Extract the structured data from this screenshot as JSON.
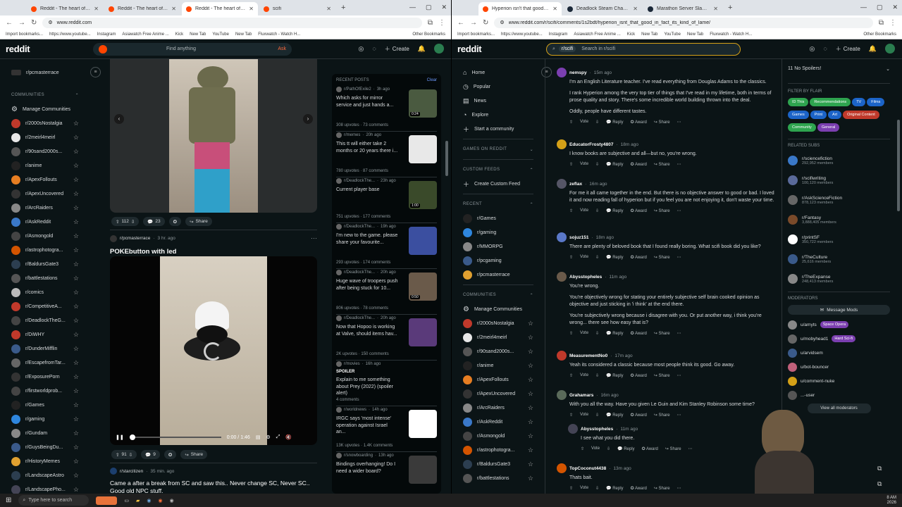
{
  "left": {
    "tabs": [
      {
        "label": "Reddit - The heart of the intern",
        "active": false
      },
      {
        "label": "Reddit - The heart of the intern",
        "active": false
      },
      {
        "label": "Reddit - The heart of the intern",
        "active": true
      },
      {
        "label": "scifi",
        "active": false
      }
    ],
    "url": "www.reddit.com",
    "bookmarks": [
      "Import bookmarks...",
      "https://www.youtube...",
      "Instagram",
      "Asiawatch Free Anime ...",
      "Kick",
      "New Tab",
      "YouTube",
      "New Tab",
      "Fluxwatch - Watch H..."
    ],
    "bookmarks_other": "Other Bookmarks",
    "header": {
      "logo": "reddit",
      "search": "Find anything",
      "ask": "Ask",
      "create": "Create"
    },
    "sidebar": {
      "top_item": "r/pcmasterrace",
      "communities_title": "COMMUNITIES",
      "manage": "Manage Communities",
      "items": [
        "r/2000sNostalgia",
        "r/2meirl4meirl",
        "r/90sand2000s...",
        "r/anime",
        "r/ApexFollouts",
        "r/ApexUncovered",
        "r/ArcRaiders",
        "r/AskReddit",
        "r/Asmongold",
        "r/astrophotogra...",
        "r/BaldursGate3",
        "r/battlestations",
        "r/comics",
        "r/CompetitiveA...",
        "r/DeadlockTheG...",
        "r/DiWHY",
        "r/DunderMifflin",
        "r/EscapefromTar...",
        "r/ExposurePorn",
        "r/firstworldprob...",
        "r/Games",
        "r/gaming",
        "r/Gundam",
        "r/GuysBeingDu...",
        "r/HistoryMemes",
        "r/LandscapeAstro",
        "r/LandscapePho..."
      ]
    },
    "post1": {
      "upvotes": "112",
      "comments": "23",
      "share": "Share"
    },
    "post2": {
      "sub": "r/pcmasterrace",
      "time": "3 hr. ago",
      "title": "POKEbutton with led",
      "upvotes": "91",
      "comments": "9",
      "share": "Share",
      "video_time": "0:00 / 1:46"
    },
    "post3": {
      "sub": "r/starcitizen",
      "time": "35 min. ago",
      "title": "Came a after a break from SC and saw this.. Never change SC, Never SC.. Good old NPC stuff."
    },
    "recent": {
      "title": "RECENT POSTS",
      "clear": "Clear",
      "items": [
        {
          "sub": "r/PathOfExile2",
          "time": "3h ago",
          "title": "Which asks for mirror service and just hands a...",
          "stats": "308 upvotes · 73 comments",
          "thumb": "#4a5a40",
          "dur": "0:24"
        },
        {
          "sub": "r/memes",
          "time": "20h ago",
          "title": "This tt will either take 2 months or 20 years there i...",
          "stats": "780 upvotes · 87 comments",
          "thumb": "#e8e8e8",
          "dur": ""
        },
        {
          "sub": "r/DeadlockThe...",
          "time": "23h ago",
          "title": "Current player base",
          "stats": "751 upvotes · 177 comments",
          "thumb": "#3a4a2a",
          "dur": "1:00"
        },
        {
          "sub": "r/DeadlockThe...",
          "time": "19h ago",
          "title": "I'm new to the game. please share your favourite...",
          "stats": "293 upvotes · 174 comments",
          "thumb": "#3b4fa0",
          "dur": ""
        },
        {
          "sub": "r/DeadlockThe...",
          "time": "20h ago",
          "title": "Huge wave of troopers push after being stuck for 10...",
          "stats": "806 upvotes · 78 comments",
          "thumb": "#6a5a4a",
          "dur": "0:50"
        },
        {
          "sub": "r/DeadlockThe...",
          "time": "20h ago",
          "title": "Now that Hopoo is working at Valve, should items hav...",
          "stats": "2K upvotes · 150 comments",
          "thumb": "#5a3a7a",
          "dur": ""
        },
        {
          "sub": "r/movies",
          "time": "16h ago",
          "title": "Explain to me something about Prey (2022) (spoiler alert)",
          "stats": "4 comments",
          "thumb": "",
          "dur": "",
          "spoiler": "SPOILER"
        },
        {
          "sub": "r/worldnews",
          "time": "14h ago",
          "title": "IRGC says 'most intense' operation against Israel an...",
          "stats": "13K upvotes · 1.4K comments",
          "thumb": "#ffffff",
          "dur": ""
        },
        {
          "sub": "r/snowboarding",
          "time": "13h ago",
          "title": "Bindings overhanging! Do I need a wider board?",
          "stats": "",
          "thumb": "#3a3a3a",
          "dur": ""
        }
      ]
    }
  },
  "right": {
    "tabs": [
      {
        "label": "Hyperion isn't that good, in fa",
        "active": true
      },
      {
        "label": "Deadlock Steam Charts - Steam",
        "active": false
      },
      {
        "label": "Marathon Server Slam Steam D",
        "active": false
      }
    ],
    "url": "www.reddit.com/r/scifi/comments/1s2bdt/hyperion_isnt_that_good_in_fact_its_kind_of_lame/",
    "bookmarks": [
      "Import bookmarks...",
      "https://www.youtube...",
      "Instagram",
      "Asiawatch Free Anime ...",
      "Kick",
      "New Tab",
      "YouTube",
      "New Tab",
      "Fluxwatch - Watch H..."
    ],
    "bookmarks_other": "Other Bookmarks",
    "header": {
      "logo": "reddit",
      "search_chip": "r/scifi",
      "search": "Search in r/scifi",
      "create": "Create"
    },
    "nav": {
      "home": "Home",
      "popular": "Popular",
      "news": "News",
      "explore": "Explore",
      "start": "Start a community",
      "games": "GAMES ON REDDIT",
      "custom": "CUSTOM FEEDS",
      "create_feed": "Create Custom Feed",
      "recent": "RECENT",
      "communities": "COMMUNITIES",
      "manage": "Manage Communities"
    },
    "recent_items": [
      "r/Games",
      "r/gaming",
      "r/MMORPG",
      "r/pcgaming",
      "r/pcmasterrace"
    ],
    "community_items": [
      "r/2000sNostalgia",
      "r/2meirl4meirl",
      "r/90sand2000s...",
      "r/anime",
      "r/ApexFollouts",
      "r/ApexUncovered",
      "r/ArcRaiders",
      "r/AskReddit",
      "r/Asmongold",
      "r/astrophotogra...",
      "r/BaldursGate3",
      "r/battlestations"
    ],
    "comments": [
      {
        "user": "nemspy",
        "time": "15m ago",
        "paras": [
          "I'm an English Literature teacher. I've read everything from Douglas Adams to the classics.",
          "I rank Hyperion among the very top tier of things that I've read in my lifetime, both in terms of prose quality and story. There's some incredible world building thrown into the deal.",
          "Oddly, people have different tastes."
        ]
      },
      {
        "user": "EducatorFrosty4807",
        "time": "18m ago",
        "paras": [
          "I know books are subjective and all—but no, you're wrong."
        ]
      },
      {
        "user": "zeflax",
        "time": "16m ago",
        "paras": [
          "For me it all came together in the end. But there is no objective answer to good or bad. I loved it and now reading fall of hyperion but if you feel you are not enjoying it, don't waste your time."
        ]
      },
      {
        "user": "sojuz151",
        "time": "18m ago",
        "paras": [
          "There are plenty of beloved book that I found really boring. What scifi book did you like?"
        ]
      },
      {
        "user": "Abysstopheles",
        "time": "11m ago",
        "paras": [
          "You're wrong.",
          "You're objectively wrong for stating your entirely subjective self brain cooked opinion as objective and just sticking in 'i think' at the end there.",
          "You're subjectively wrong because i disagree with you. Or put another way, i think you're wrong... there see how easy that is?"
        ]
      },
      {
        "user": "MeasurementNo0",
        "time": "17m ago",
        "paras": [
          "Yeah its considered a classic because most people think its good. Go away."
        ]
      },
      {
        "user": "Grahamars",
        "time": "16m ago",
        "paras": [
          "With you all the way. Have you given Le Guin and Kim Stanley Robinson some time?"
        ]
      },
      {
        "user": "Abysstopheles",
        "time": "11m ago",
        "paras": [
          "I see what you did there."
        ]
      },
      {
        "user": "TopCoconut4438",
        "time": "13m ago",
        "paras": [
          "Thats bait."
        ]
      }
    ],
    "actions": {
      "vote": "Vote",
      "reply": "Reply",
      "award": "Award",
      "share": "Share"
    },
    "sidebar": {
      "rule": "11  No Spoilers!",
      "flair_title": "FILTER BY FLAIR",
      "flairs": [
        {
          "label": "ID This",
          "color": "#2ea44f"
        },
        {
          "label": "Recommendations",
          "color": "#2ea44f"
        },
        {
          "label": "TV",
          "color": "#1c64c8"
        },
        {
          "label": "Films",
          "color": "#1c64c8"
        },
        {
          "label": "Games",
          "color": "#1c64c8"
        },
        {
          "label": "Print",
          "color": "#1c64c8"
        },
        {
          "label": "Art",
          "color": "#1c64c8"
        },
        {
          "label": "Original Content",
          "color": "#c0392b"
        },
        {
          "label": "Community",
          "color": "#2ea44f"
        },
        {
          "label": "General",
          "color": "#7b3fb0"
        }
      ],
      "related_title": "RELATED SUBS",
      "related": [
        {
          "name": "r/sciencefiction",
          "members": "292,952 members"
        },
        {
          "name": "r/scifiwriting",
          "members": "100,120 members"
        },
        {
          "name": "r/AskScienceFiction",
          "members": "878,123 members"
        },
        {
          "name": "r/Fantasy",
          "members": "3,888,405 members"
        },
        {
          "name": "r/printSF",
          "members": "350,722 members"
        },
        {
          "name": "r/TheCulture",
          "members": "25,616 members"
        },
        {
          "name": "r/TheExpanse",
          "members": "248,413 members"
        }
      ],
      "mods_title": "MODERATORS",
      "message_mods": "Message Mods",
      "mods": [
        {
          "name": "u/amyts",
          "tag": "Space Opera",
          "tagcolor": "#7b3fb0"
        },
        {
          "name": "u/mobyhead1",
          "tag": "Hard Sci-fi",
          "tagcolor": "#7b3fb0"
        },
        {
          "name": "u/arvidsem",
          "tag": "",
          "tagcolor": ""
        },
        {
          "name": "u/bot-bouncer",
          "tag": "",
          "tagcolor": ""
        },
        {
          "name": "u/comment-nuke",
          "tag": "",
          "tagcolor": ""
        },
        {
          "name": "...-user",
          "tag": "",
          "tagcolor": ""
        }
      ],
      "view_all": "View all moderators"
    }
  },
  "taskbar": {
    "search": "Type here to search",
    "time": "8 AM",
    "date": "2026"
  }
}
